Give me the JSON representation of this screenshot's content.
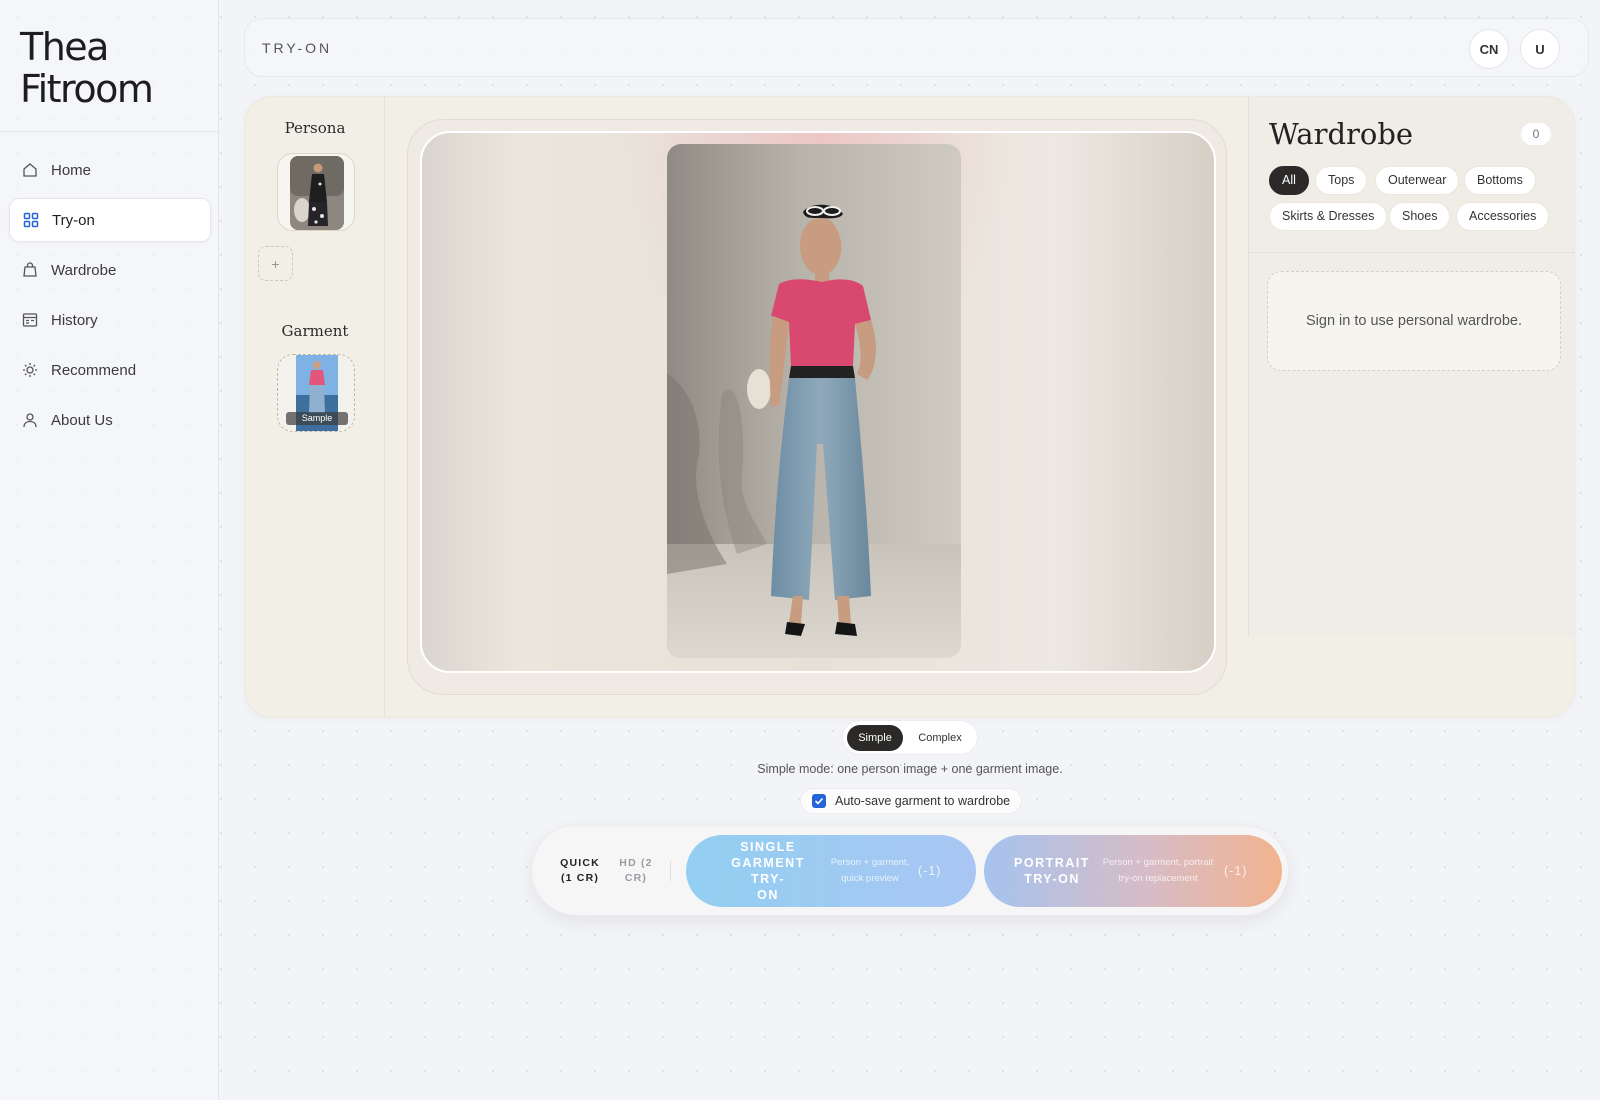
{
  "brand": {
    "line1": "Thea",
    "line2": "Fitroom"
  },
  "nav": [
    {
      "label": "Home",
      "icon": "home-icon"
    },
    {
      "label": "Try-on",
      "icon": "grid-icon",
      "active": true
    },
    {
      "label": "Wardrobe",
      "icon": "bag-icon"
    },
    {
      "label": "History",
      "icon": "history-icon"
    },
    {
      "label": "Recommend",
      "icon": "sun-icon"
    },
    {
      "label": "About Us",
      "icon": "user-icon"
    }
  ],
  "topbar": {
    "title": "TRY-ON",
    "lang_button": "CN",
    "user_button": "U"
  },
  "persona": {
    "label": "Persona",
    "add_label": "+"
  },
  "garment": {
    "label": "Garment",
    "sample_tag": "Sample"
  },
  "wardrobe": {
    "title": "Wardrobe",
    "count": "0",
    "filters": [
      "All",
      "Tops",
      "Outerwear",
      "Bottoms",
      "Skirts & Dresses",
      "Shoes",
      "Accessories"
    ],
    "active_filter": "All",
    "empty_message": "Sign in to use personal wardrobe."
  },
  "mode": {
    "options": [
      "Simple",
      "Complex"
    ],
    "selected": "Simple",
    "hint": "Simple mode: one person image + one garment image."
  },
  "autosave": {
    "label": "Auto-save garment to wardrobe",
    "checked": true
  },
  "quality": {
    "quick": {
      "line1": "QUICK",
      "line2": "(1 CR)",
      "selected": true
    },
    "hd": {
      "line1": "HD (2",
      "line2": "CR)",
      "selected": false
    }
  },
  "actions": {
    "single": {
      "title_l1": "SINGLE",
      "title_l2": "GARMENT TRY-",
      "title_l3": "ON",
      "desc_l1": "Person + garment,",
      "desc_l2": "quick preview",
      "cost": "(-1)"
    },
    "portrait": {
      "title_l1": "PORTRAIT",
      "title_l2": "TRY-ON",
      "desc_l1": "Person + garment, portrait",
      "desc_l2": "try-on replacement",
      "cost": "(-1)"
    }
  },
  "colors": {
    "accent_blue": "#2563d9",
    "single_gradient": [
      "#93cff2",
      "#a9c6f3"
    ],
    "portrait_gradient": [
      "#a6c3ee",
      "#f2b38e"
    ],
    "dark_chip": "#2b2a28"
  }
}
